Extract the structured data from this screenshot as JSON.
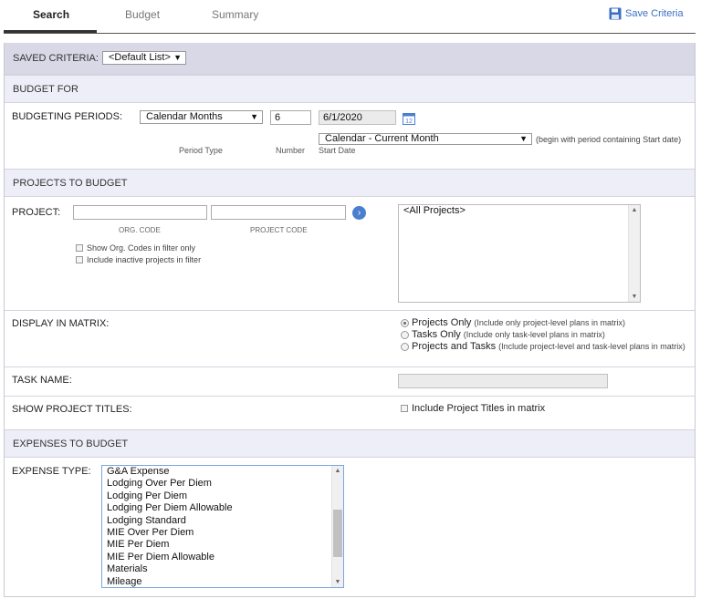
{
  "tabs": [
    {
      "label": "Search"
    },
    {
      "label": "Budget"
    },
    {
      "label": "Summary"
    }
  ],
  "save_criteria_label": "Save Criteria",
  "saved_criteria": {
    "label": "SAVED CRITERIA:",
    "value": "<Default List>"
  },
  "budget_for": {
    "header": "BUDGET FOR",
    "periods_label": "BUDGETING PERIODS:",
    "period_type_value": "Calendar Months",
    "number_value": "6",
    "start_date_value": "6/1/2020",
    "start_date_mode": "Calendar - Current Month",
    "hint": "(begin with period containing Start date)",
    "period_type_caption": "Period Type",
    "number_caption": "Number",
    "start_date_caption": "Start Date"
  },
  "projects": {
    "header": "PROJECTS TO BUDGET",
    "project_label": "PROJECT:",
    "org_code_caption": "ORG. CODE",
    "project_code_caption": "PROJECT CODE",
    "org_code_value": "",
    "project_code_value": "",
    "show_org_codes": "Show Org. Codes in filter only",
    "include_inactive": "Include inactive projects in filter",
    "list_items": [
      "<All Projects>"
    ]
  },
  "display_matrix": {
    "label": "DISPLAY IN MATRIX:",
    "options": [
      {
        "label": "Projects Only",
        "note": "(Include only project-level plans in matrix)",
        "checked": true
      },
      {
        "label": "Tasks Only",
        "note": "(Include only task-level plans in matrix)",
        "checked": false
      },
      {
        "label": "Projects and Tasks",
        "note": "(Include project-level and task-level plans in matrix)",
        "checked": false
      }
    ]
  },
  "task_name": {
    "label": "TASK NAME:",
    "value": ""
  },
  "show_titles": {
    "label": "SHOW PROJECT TITLES:",
    "checkbox": "Include Project Titles in matrix"
  },
  "expenses": {
    "header": "EXPENSES TO BUDGET",
    "type_label": "EXPENSE TYPE:",
    "items": [
      "G&A Expense",
      "Lodging Over Per Diem",
      "Lodging Per Diem",
      "Lodging Per Diem Allowable",
      "Lodging Standard",
      "MIE Over Per Diem",
      "MIE Per Diem",
      "MIE Per Diem Allowable",
      "Materials",
      "Mileage"
    ]
  },
  "colors": {
    "accent": "#3a6fc4",
    "header_bg": "#eeeef8",
    "header_bg_dark": "#d8d8e6"
  },
  "icons": {
    "save": "floppy-disk-icon",
    "calendar": "calendar-icon",
    "go": "arrow-right-circle-icon"
  }
}
